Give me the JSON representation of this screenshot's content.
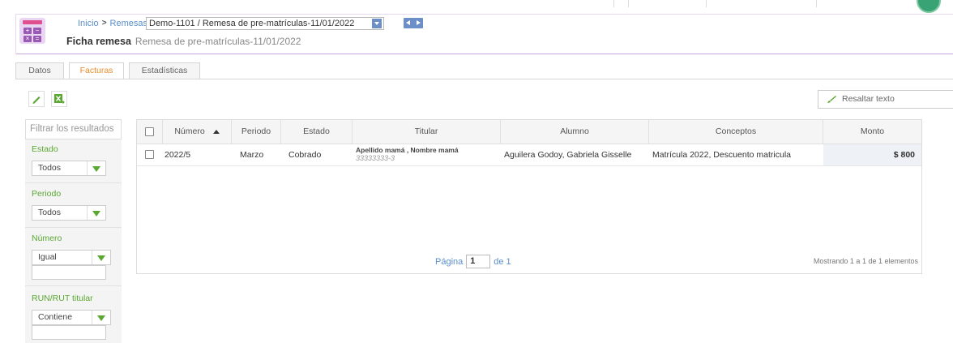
{
  "breadcrumb": {
    "home": "Inicio",
    "section": "Remesas",
    "current": "Demo-1101 / Remesa de pre-matrículas-11/01/2022"
  },
  "title": {
    "label": "Ficha remesa",
    "subtitle": "Remesa de pre-matrículas-11/01/2022"
  },
  "tabs": [
    {
      "label": "Datos",
      "active": false
    },
    {
      "label": "Facturas",
      "active": true
    },
    {
      "label": "Estadísticas",
      "active": false
    }
  ],
  "toolbar": {
    "highlight_placeholder": "Resaltar texto"
  },
  "filters": {
    "search_placeholder": "Filtrar los resultados",
    "estado": {
      "label": "Estado",
      "value": "Todos"
    },
    "periodo": {
      "label": "Periodo",
      "value": "Todos"
    },
    "numero": {
      "label": "Número",
      "value": "Igual"
    },
    "run": {
      "label": "RUN/RUT titular",
      "value": "Contiene"
    }
  },
  "table": {
    "headers": {
      "numero": "Número",
      "periodo": "Periodo",
      "estado": "Estado",
      "titular": "Titular",
      "alumno": "Alumno",
      "conceptos": "Conceptos",
      "monto": "Monto"
    },
    "rows": [
      {
        "numero": "2022/5",
        "periodo": "Marzo",
        "estado": "Cobrado",
        "titular_name": "Apellido mamá , Nombre mamá",
        "titular_rut": "33333333-3",
        "alumno": "Aguilera Godoy, Gabriela Gisselle",
        "conceptos": "Matrícula 2022, Descuento matricula",
        "monto": "$ 800"
      }
    ]
  },
  "pager": {
    "page_label": "Página",
    "page": "1",
    "of_label": "de 1",
    "showing": "Mostrando 1 a 1 de 1 elementos"
  },
  "colors": {
    "accent_purple": "#9b59b6",
    "link_blue": "#5a8fc9",
    "active_tab_orange": "#e88c2d",
    "filter_green": "#5aa832"
  },
  "icons": {
    "app": "calculator-icon",
    "edit": "pencil-icon",
    "export": "excel-export-icon",
    "highlight": "brush-icon"
  }
}
